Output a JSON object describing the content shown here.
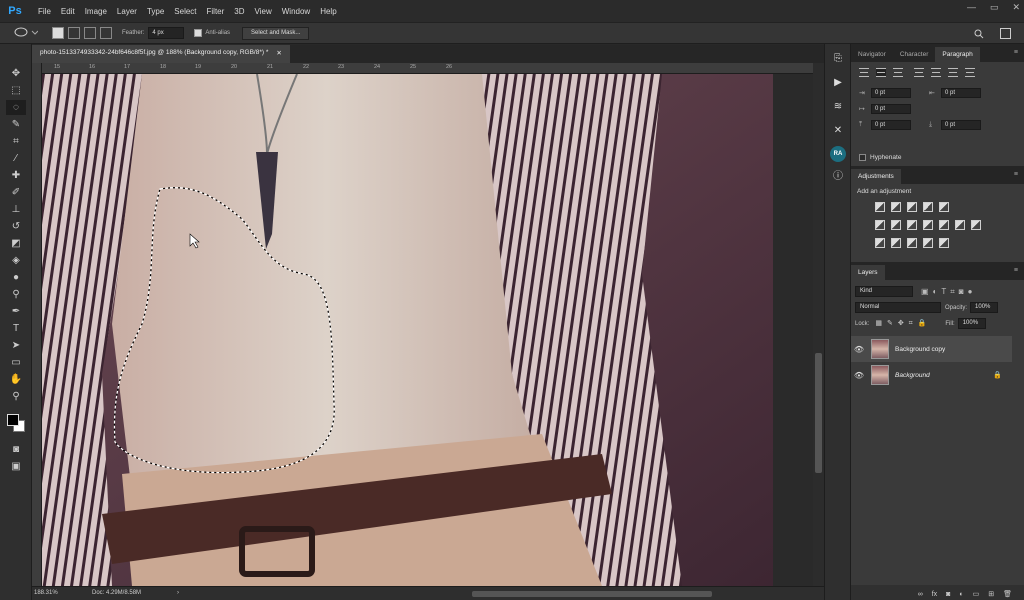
{
  "app": {
    "logo": "Ps"
  },
  "menu": [
    "File",
    "Edit",
    "Image",
    "Layer",
    "Type",
    "Select",
    "Filter",
    "3D",
    "View",
    "Window",
    "Help"
  ],
  "window_controls": {
    "minimize": "—",
    "maximize": "▭",
    "close": "✕"
  },
  "options_bar": {
    "feather_label": "Feather:",
    "feather_value": "4 px",
    "antialias_label": "Anti-alias",
    "select_mask_label": "Select and Mask..."
  },
  "document": {
    "tab_title": "photo-1513374933342-24bf646c8f5f.jpg @ 188% (Background copy, RGB/8*) *",
    "close_glyph": "✕"
  },
  "ruler_marks": [
    "15",
    "16",
    "17",
    "18",
    "19",
    "20",
    "21",
    "22",
    "23",
    "24",
    "25",
    "26"
  ],
  "status": {
    "zoom": "188.31%",
    "doc": "Doc: 4.29M/8.58M",
    "arrow": "›"
  },
  "panels": {
    "top_tabs": [
      "Navigator",
      "Character",
      "Paragraph"
    ],
    "paragraph": {
      "indent_left": "0 pt",
      "indent_right": "0 pt",
      "first_line": "0 pt",
      "space_before": "0 pt",
      "space_after": "0 pt",
      "hyphenate_label": "Hyphenate"
    },
    "adjustments": {
      "tab": "Adjustments",
      "title": "Add an adjustment"
    },
    "layers": {
      "tab": "Layers",
      "kind_label": "Kind",
      "blend_mode": "Normal",
      "opacity_label": "Opacity:",
      "opacity_value": "100%",
      "lock_label": "Lock:",
      "fill_label": "Fill:",
      "fill_value": "100%",
      "items": [
        {
          "name": "Background copy",
          "selected": true
        },
        {
          "name": "Background",
          "selected": false,
          "locked": true
        }
      ]
    }
  },
  "colors": {
    "foreground": "#000000",
    "background": "#ffffff",
    "accent": "#31a8ff"
  }
}
